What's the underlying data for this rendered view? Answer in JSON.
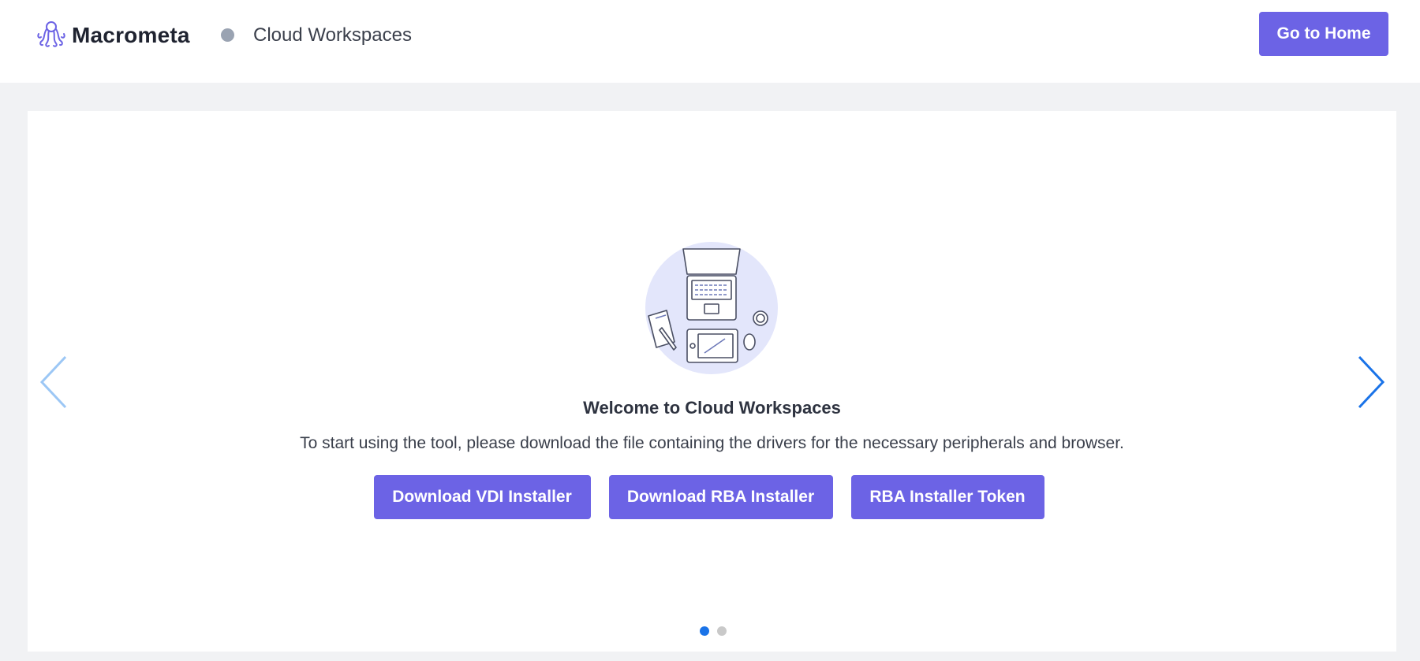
{
  "header": {
    "brand_name": "Macrometa",
    "app_title": "Cloud Workspaces",
    "home_button_label": "Go to Home"
  },
  "main": {
    "illustration_icon": "workspace-desk-illustration",
    "title": "Welcome to Cloud Workspaces",
    "description": "To start using the tool, please download the file containing the drivers for the necessary peripherals and browser.",
    "buttons": [
      {
        "label": "Download VDI Installer"
      },
      {
        "label": "Download RBA Installer"
      },
      {
        "label": "RBA Installer Token"
      }
    ]
  },
  "carousel": {
    "prev_icon": "chevron-left-icon",
    "next_icon": "chevron-right-icon",
    "slide_count": 2,
    "active_slide": 1
  },
  "colors": {
    "accent": "#6c63e5",
    "page_background": "#f1f2f4",
    "header_dot": "#9aa3b2",
    "active_dot": "#1a73e8",
    "inactive_dot": "#c9c9c9",
    "arrow_prev": "#9cc7f5",
    "arrow_next": "#1a73e8",
    "illustration_circle": "#e3e6fb"
  }
}
